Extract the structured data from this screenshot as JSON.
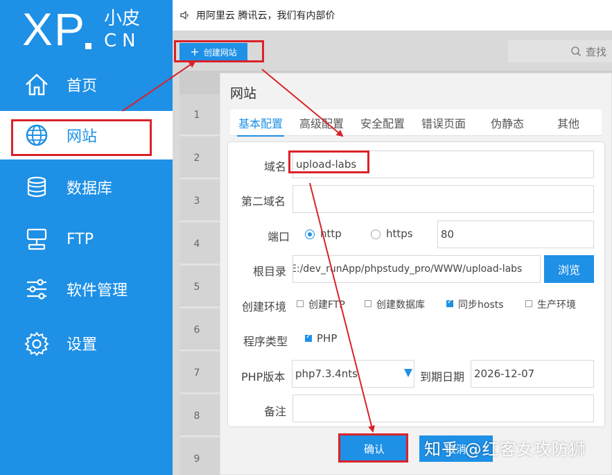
{
  "logo": {
    "main": "XP",
    "cn_top": "小皮",
    "cn_bottom": "CN"
  },
  "sidebar": {
    "items": [
      {
        "label": "首页",
        "icon": "home-icon"
      },
      {
        "label": "网站",
        "icon": "globe-icon",
        "active": true
      },
      {
        "label": "数据库",
        "icon": "database-icon"
      },
      {
        "label": "FTP",
        "icon": "ftp-icon"
      },
      {
        "label": "软件管理",
        "icon": "sliders-icon"
      },
      {
        "label": "设置",
        "icon": "gear-icon"
      }
    ]
  },
  "topbar": {
    "notice": "用阿里云 腾讯云，我们有内部价"
  },
  "content": {
    "create_label": "创建网站",
    "search_label": "查找",
    "row_numbers": [
      "1",
      "2",
      "3",
      "4",
      "5",
      "6",
      "7",
      "8",
      "9"
    ]
  },
  "dialog": {
    "title": "网站",
    "tabs": [
      "基本配置",
      "高级配置",
      "安全配置",
      "错误页面",
      "伪静态",
      "其他"
    ],
    "form": {
      "domain_label": "域名",
      "domain_value": "upload-labs",
      "second_domain_label": "第二域名",
      "second_domain_value": "",
      "port_label": "端口",
      "http_label": "http",
      "https_label": "https",
      "port_value": "80",
      "root_label": "根目录",
      "root_value": "E:/dev_runApp/phpstudy_pro/WWW/upload-labs",
      "browse_label": "浏览",
      "env_label": "创建环境",
      "env_options": [
        {
          "label": "创建FTP",
          "checked": false
        },
        {
          "label": "创建数据库",
          "checked": false
        },
        {
          "label": "同步hosts",
          "checked": true
        },
        {
          "label": "生产环境",
          "checked": false
        }
      ],
      "type_label": "程序类型",
      "type_option": "PHP",
      "php_label": "PHP版本",
      "php_value": "php7.3.4nts",
      "expire_label": "到期日期",
      "expire_value": "2026-12-07",
      "note_label": "备注",
      "note_value": ""
    },
    "confirm_label": "确认",
    "cancel_label": "取消"
  },
  "watermark": "知乎 @红客女攻防狮",
  "colors": {
    "accent": "#1e90e6",
    "annotation": "#d9222a"
  }
}
